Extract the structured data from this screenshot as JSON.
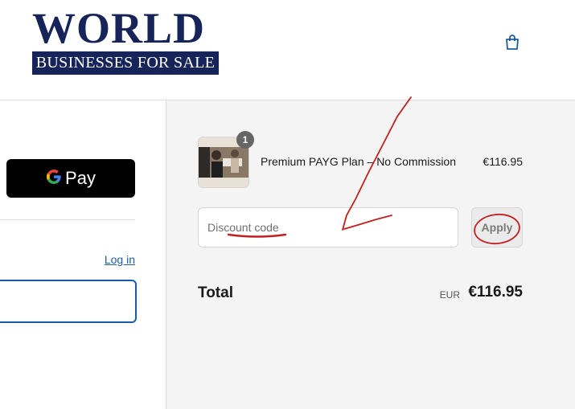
{
  "brand": {
    "logo_top": "WORLD",
    "logo_bottom": "BUSINESSES FOR SALE",
    "primary_color": "#16245a"
  },
  "header": {
    "cart_icon": "shopping-bag-icon"
  },
  "express_checkout": {
    "gpay_pay_label": "Pay",
    "gpay_g_label": "G"
  },
  "contact": {
    "login_label": "Log in",
    "email_value": ""
  },
  "order_summary": {
    "item": {
      "name": "Premium PAYG Plan – No Commission",
      "price": "€116.95",
      "quantity": "1"
    },
    "discount": {
      "placeholder": "Discount code",
      "apply_label": "Apply"
    },
    "total": {
      "label": "Total",
      "currency": "EUR",
      "amount": "€116.95"
    }
  },
  "colors": {
    "link": "#1a5ba8",
    "summary_bg": "#f4f4f4",
    "annotation": "#c41e1e"
  }
}
